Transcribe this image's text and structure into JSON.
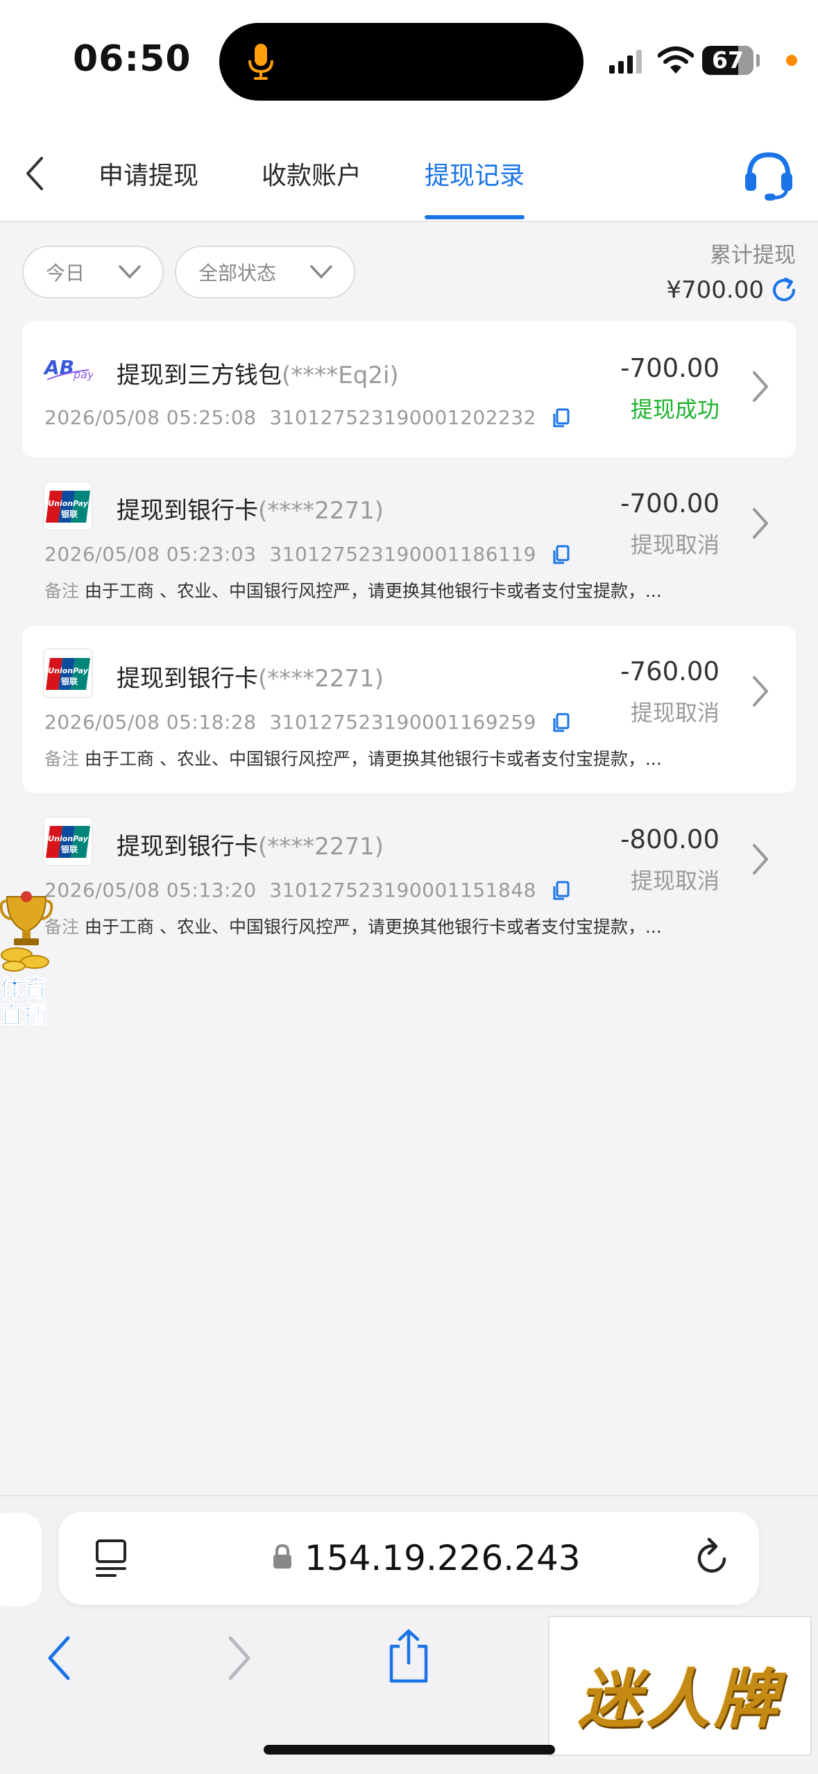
{
  "status_bar": {
    "time": "06:50",
    "battery": "67"
  },
  "nav": {
    "tabs": [
      {
        "label": "申请提现"
      },
      {
        "label": "收款账户"
      },
      {
        "label": "提现记录"
      }
    ],
    "active_tab": "提现记录"
  },
  "filters": {
    "date": "今日",
    "status": "全部状态"
  },
  "summary": {
    "label": "累计提现",
    "value": "¥700.00"
  },
  "records": [
    {
      "title": "提现到三方钱包",
      "account": "(****Eq2i)",
      "datetime": "2026/05/08 05:25:08",
      "order_no": "31012752319000120223​2",
      "amount": "-700.00",
      "status": "提现成功",
      "remark_label": "",
      "remark": "",
      "logo": "ab-pay-logo"
    },
    {
      "title": "提现到银行卡",
      "account": "(****2271)",
      "datetime": "2026/05/08 05:23:03",
      "order_no": "310127523190001186119",
      "amount": "-700.00",
      "status": "提现取消",
      "remark_label": "备注",
      "remark": "由于工商 、农业、中国银行风控严，请更换其他银行卡或者支付宝提款，...",
      "logo": "unionpay-logo"
    },
    {
      "title": "提现到银行卡",
      "account": "(****2271)",
      "datetime": "2026/05/08 05:18:28",
      "order_no": "310127523190001169259",
      "amount": "-760.00",
      "status": "提现取消",
      "remark_label": "备注",
      "remark": "由于工商 、农业、中国银行风控严，请更换其他银行卡或者支付宝提款，...",
      "logo": "unionpay-logo"
    },
    {
      "title": "提现到银行卡",
      "account": "(****2271)",
      "datetime": "2026/05/08 05:13:20",
      "order_no": "310127523190001151848",
      "amount": "-800.00",
      "status": "提现取消",
      "remark_label": "备注",
      "remark": "由于工商 、农业、中国银行风控严，请更换其他银行卡或者支付宝提款，...",
      "logo": "unionpay-logo"
    }
  ],
  "float_badge": {
    "line1": "体育",
    "line2": "直播"
  },
  "browser": {
    "url": "154.19.226.243"
  },
  "ad": {
    "text": "迷人牌"
  },
  "colors": {
    "accent": "#1a74e8",
    "success": "#1db32d",
    "muted": "#9a9a9a"
  }
}
